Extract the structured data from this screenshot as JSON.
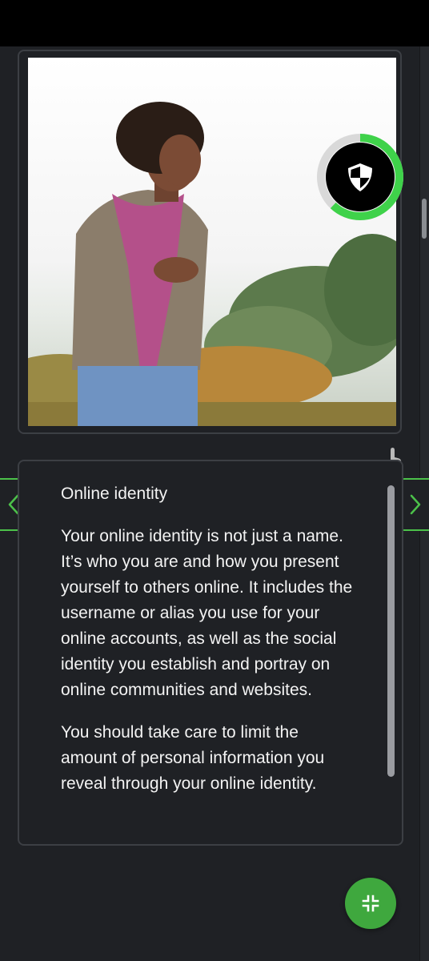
{
  "card": {
    "title": "Online identity",
    "paragraphs": [
      "Your online identity is not just a name. It’s who you are and how you present yourself to others online. It includes the username or alias you use for your online accounts, as well as the social identity you establish and portray on online communities and websites.",
      "You should take care to limit the amount of personal information you reveal through your online identity."
    ]
  },
  "progress": {
    "fraction": 0.62,
    "icon": "shield-icon",
    "ring_color": "#3fd24a"
  },
  "image": {
    "subject": "woman-photo"
  },
  "icons": {
    "prev": "chevron-left-icon",
    "next": "chevron-right-icon",
    "fab": "collapse-icon",
    "tap": "tap-hand-icon"
  },
  "colors": {
    "accent": "#4cc14a",
    "background": "#1f2125",
    "fab": "#3fa83e"
  }
}
